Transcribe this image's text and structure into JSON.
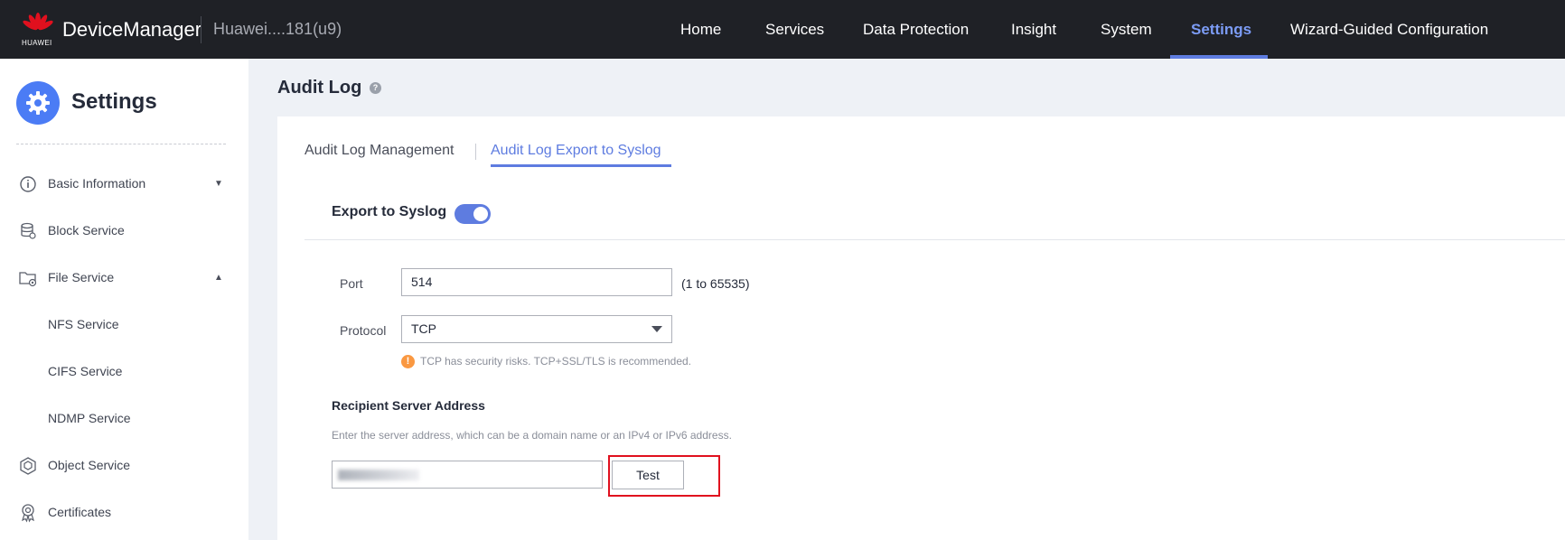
{
  "header": {
    "brand": "HUAWEI",
    "app_title": "DeviceManager",
    "device_name": "Huawei....181(u9)",
    "nav": [
      {
        "label": "Home"
      },
      {
        "label": "Services"
      },
      {
        "label": "Data Protection"
      },
      {
        "label": "Insight"
      },
      {
        "label": "System"
      },
      {
        "label": "Settings",
        "active": true
      },
      {
        "label": "Wizard-Guided Configuration"
      }
    ]
  },
  "sidebar": {
    "title": "Settings",
    "items": [
      {
        "label": "Basic Information",
        "icon": "info-icon",
        "caret": "down"
      },
      {
        "label": "Block Service",
        "icon": "database-icon"
      },
      {
        "label": "File Service",
        "icon": "folder-gear-icon",
        "caret": "up"
      },
      {
        "label": "NFS Service",
        "sub": true
      },
      {
        "label": "CIFS Service",
        "sub": true
      },
      {
        "label": "NDMP Service",
        "sub": true
      },
      {
        "label": "Object Service",
        "icon": "cube-icon"
      },
      {
        "label": "Certificates",
        "icon": "certificate-icon"
      }
    ]
  },
  "main": {
    "page_title": "Audit Log",
    "tabs": [
      {
        "label": "Audit Log Management"
      },
      {
        "label": "Audit Log Export to Syslog",
        "active": true
      }
    ],
    "export_label": "Export to Syslog",
    "export_enabled": true,
    "port": {
      "label": "Port",
      "value": "514",
      "hint": "(1 to 65535)"
    },
    "protocol": {
      "label": "Protocol",
      "value": "TCP",
      "warning": "TCP has security risks. TCP+SSL/TLS is recommended."
    },
    "recipient": {
      "title": "Recipient Server Address",
      "description": "Enter the server address, which can be a domain name or an IPv4 or IPv6 address."
    },
    "test_label": "Test"
  },
  "colors": {
    "accent": "#5e7ce0",
    "topbar": "#1f2126",
    "warning": "#fa9841",
    "highlight": "#e0101e"
  }
}
